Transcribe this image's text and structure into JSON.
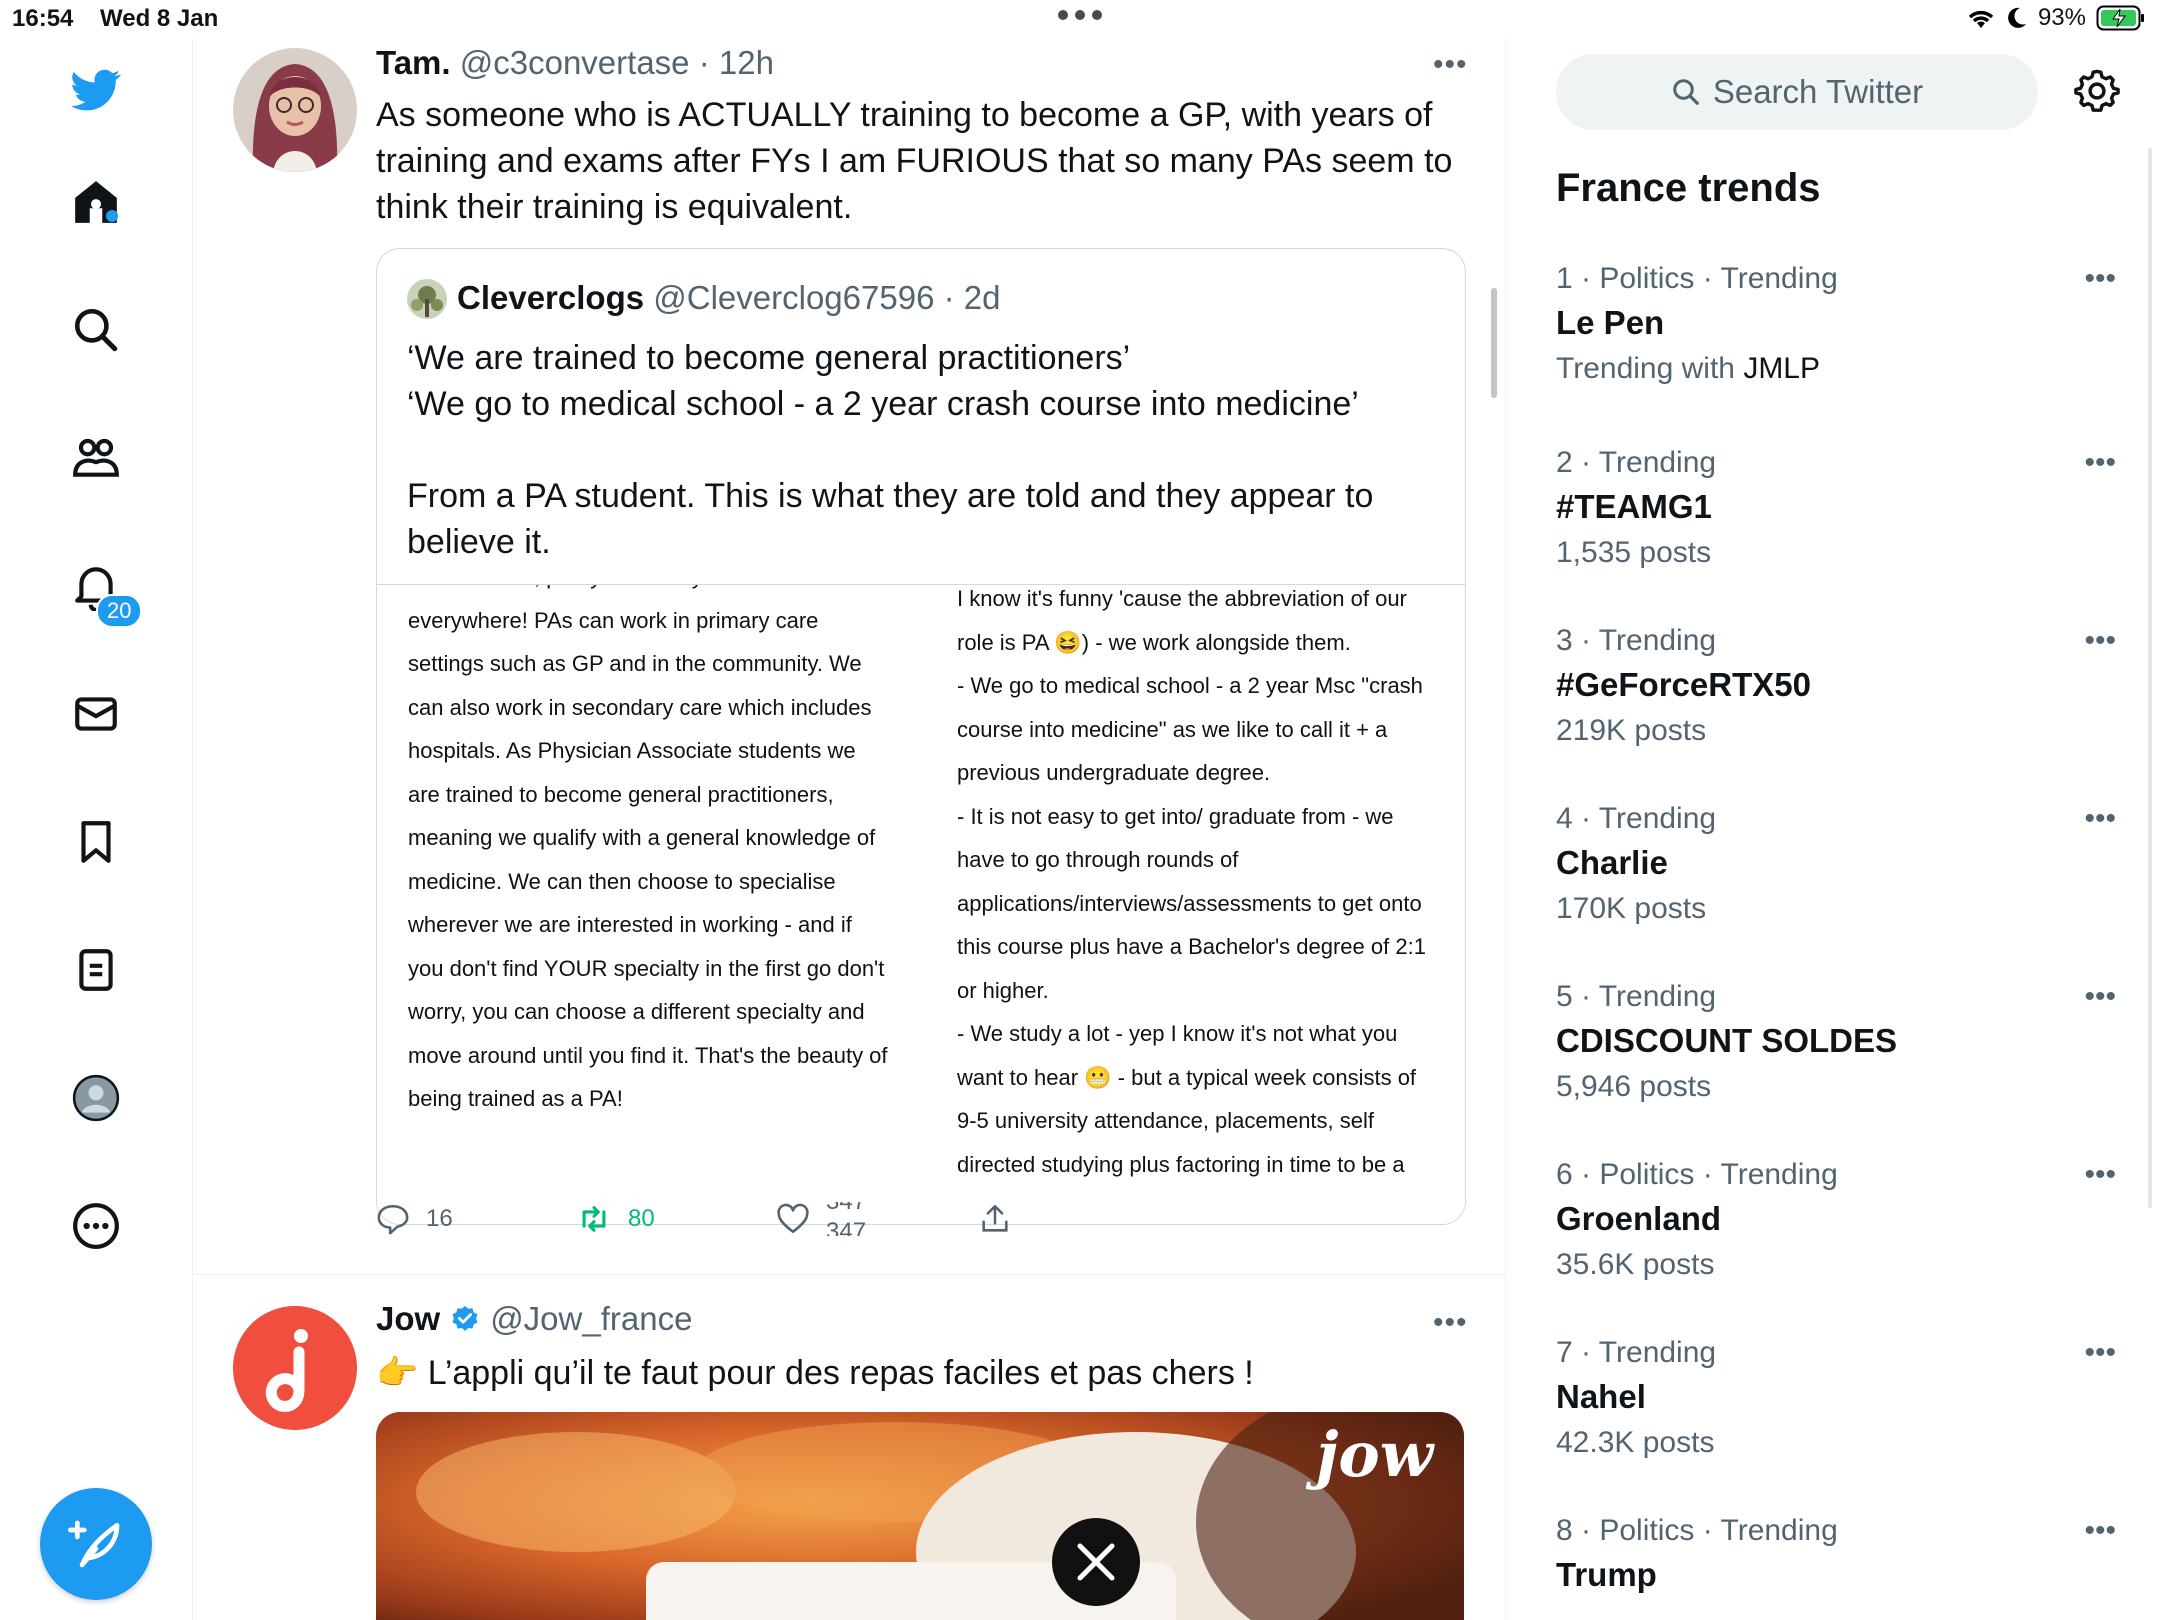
{
  "status_bar": {
    "time": "16:54",
    "date": "Wed 8 Jan",
    "battery": "93%"
  },
  "nav": {
    "notifications_badge": "20",
    "icons": [
      "twitter-logo-icon",
      "home-icon",
      "search-icon",
      "communities-icon",
      "bell-icon",
      "mail-icon",
      "bookmark-icon",
      "lists-icon",
      "profile-icon",
      "more-circle-icon"
    ]
  },
  "colors": {
    "accent": "#1d9bf0",
    "text": "#0f1419",
    "muted": "#536471",
    "retweet": "#00ba7c",
    "jow": "#f04e3e"
  },
  "tweet1": {
    "name": "Tam.",
    "handle": "@c3convertase",
    "time": "12h",
    "text_lines": [
      "As someone who is ACTUALLY training to become a GP, with years of",
      "training and exams after FYs I am FURIOUS that so many PAs seem to",
      "think their training is equivalent."
    ],
    "quote": {
      "name": "Cleverclogs",
      "handle": "@Cleverclog67596",
      "time": "2d",
      "text_lines": [
        "‘We are trained to become general practitioners’",
        "‘We go to medical school - a 2 year crash course into medicine’",
        "",
        "From a PA student. This is what they are told and they appear to",
        "believe it."
      ],
      "image_left_lines": [
        "To be honest, pretty much anywhere and",
        "everywhere! PAs can work in primary care",
        "settings such as GP and in the community. We",
        "can also work in secondary care which includes",
        "hospitals. As Physician Associate students we",
        "are trained to become general practitioners,",
        "meaning we qualify with a general knowledge of",
        "medicine. We can then choose to specialise",
        "wherever we are interested in working - and if",
        "you don't find YOUR specialty in the first go don't",
        "worry, you can choose a different specialty and",
        "move around until you find it. That's the beauty of",
        "being trained as a PA!"
      ],
      "image_right_lines": [
        "I know it's funny 'cause the abbreviation of our",
        "role is PA 😆) - we work alongside them.",
        "- We go to medical school - a 2 year Msc \"crash",
        "course into medicine\" as we like to call it + a",
        "previous undergraduate degree.",
        "- It is not easy to get into/ graduate from - we",
        "have to go through rounds of",
        "applications/interviews/assessments to get onto",
        "this course plus have a Bachelor's degree of 2:1",
        "or higher.",
        "- We study a lot - yep I know it's not what you",
        "want to hear 😬 - but a typical week consists of",
        "9-5 university attendance, placements, self",
        "directed studying plus factoring in time to be a"
      ]
    },
    "actions": {
      "replies": "16",
      "retweets": "80",
      "likes_old": "347",
      "likes": "347"
    }
  },
  "tweet2": {
    "name": "Jow",
    "handle": "@Jow_france",
    "text": "👉 L’appli qu’il te faut pour des repas faciles et pas chers !",
    "image_logo": "jow"
  },
  "search": {
    "placeholder": "Search Twitter"
  },
  "trends": {
    "title": "France trends",
    "items": [
      {
        "meta": "1 · Politics · Trending",
        "name": "Le Pen",
        "sub_prefix": "Trending with ",
        "sub_strong": "JMLP"
      },
      {
        "meta": "2 · Trending",
        "name": "#TEAMG1",
        "sub": "1,535 posts"
      },
      {
        "meta": "3 · Trending",
        "name": "#GeForceRTX50",
        "sub": "219K posts"
      },
      {
        "meta": "4 · Trending",
        "name": "Charlie",
        "sub": "170K posts"
      },
      {
        "meta": "5 · Trending",
        "name": "CDISCOUNT SOLDES",
        "sub": "5,946 posts"
      },
      {
        "meta": "6 · Politics · Trending",
        "name": "Groenland",
        "sub": "35.6K posts"
      },
      {
        "meta": "7 · Trending",
        "name": "Nahel",
        "sub": "42.3K posts"
      },
      {
        "meta": "8 · Politics · Trending",
        "name": "Trump",
        "sub": ""
      }
    ]
  }
}
